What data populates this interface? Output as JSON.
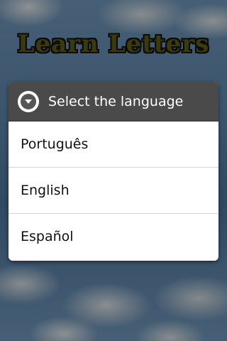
{
  "app": {
    "logo_text": "Learn Letters"
  },
  "dialog": {
    "title": "Select the language",
    "icon": "chevron-down-circle-icon",
    "options": [
      {
        "label": "Português"
      },
      {
        "label": "English"
      },
      {
        "label": "Español"
      }
    ]
  },
  "colors": {
    "header_bg": "#4a4a4a",
    "dialog_bg": "#ffffff",
    "logo_fill": "#5a5a14"
  }
}
